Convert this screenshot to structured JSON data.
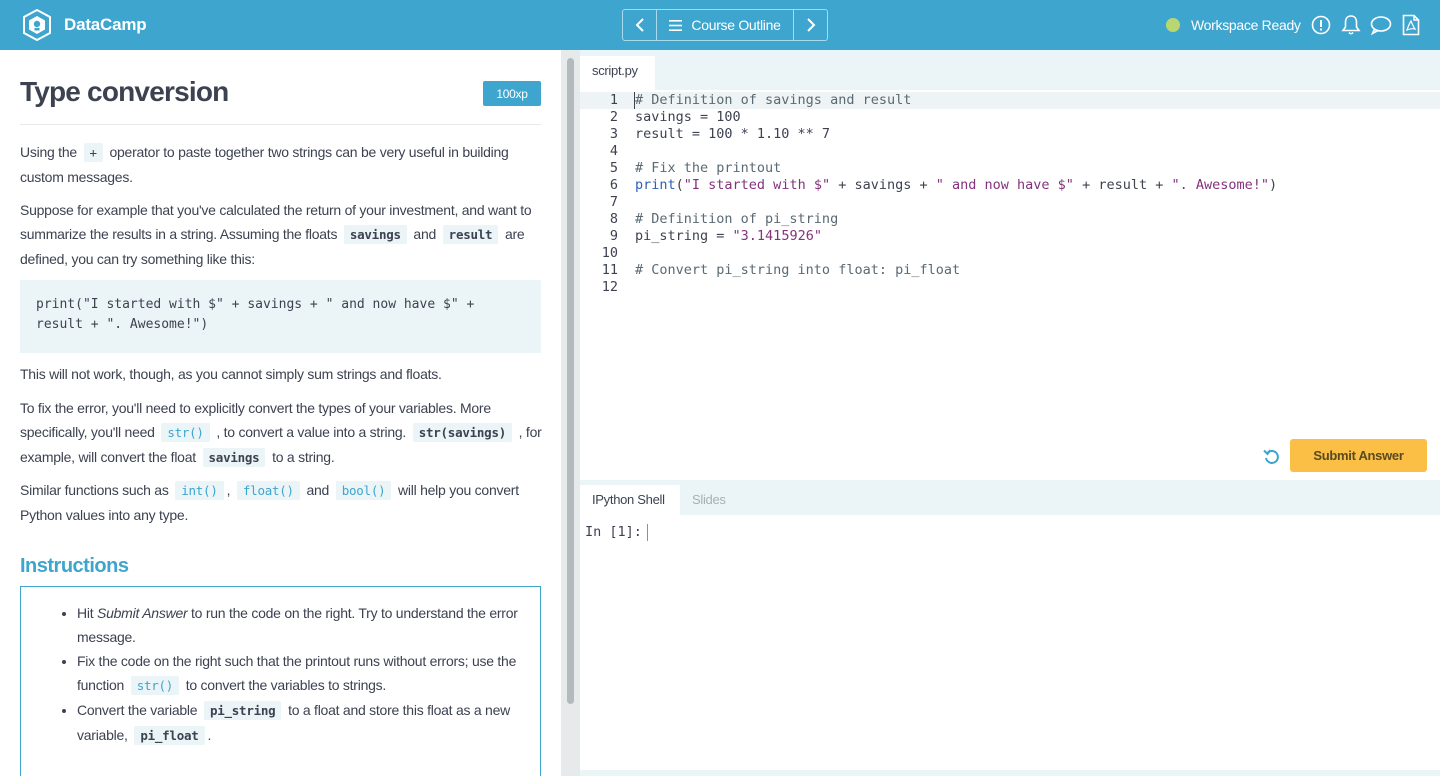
{
  "app": {
    "brand": "DataCamp",
    "course_outline_label": "Course Outline",
    "workspace_status": "Workspace Ready",
    "icons": [
      "issue-icon",
      "notification-bell-icon",
      "chat-icon",
      "pdf-icon"
    ]
  },
  "exercise": {
    "title": "Type conversion",
    "xp": "100xp",
    "p1_before": "Using the",
    "p1_code": "+",
    "p1_after": "operator to paste together two strings can be very useful in building custom messages.",
    "p2_before": "Suppose for example that you've calculated the return of your investment, and want to summarize the results in a string. Assuming the floats",
    "p2_code1": "savings",
    "p2_mid": "and",
    "p2_code2": "result",
    "p2_after": "are defined, you can try something like this:",
    "code_example_line1": "print(\"I started with $\" + savings + \" and now have $\" +",
    "code_example_line2": "result + \". Awesome!\")",
    "p3": "This will not work, though, as you cannot simply sum strings and floats.",
    "p4_before": "To fix the error, you'll need to explicitly convert the types of your variables. More specifically, you'll need",
    "p4_code1": "str()",
    "p4_mid1": ", to convert a value into a string.",
    "p4_code2": "str(savings)",
    "p4_mid2": ", for example, will convert the float",
    "p4_code3": "savings",
    "p4_after": "to a string.",
    "p5_before": "Similar functions such as",
    "p5_code1": "int()",
    "p5_sep1": ",",
    "p5_code2": "float()",
    "p5_sep2": "and",
    "p5_code3": "bool()",
    "p5_after": "will help you convert Python values into any type."
  },
  "instructions": {
    "heading": "Instructions",
    "item1_pre": "Hit",
    "item1_em": "Submit Answer",
    "item1_post": "to run the code on the right. Try to understand the error message.",
    "item2_pre": "Fix the code on the right such that the printout runs without errors; use the function",
    "item2_code": "str()",
    "item2_post": "to convert the variables to strings.",
    "item3_pre": "Convert the variable",
    "item3_code1": "pi_string",
    "item3_mid": "to a float and store this float as a new variable,",
    "item3_code2": "pi_float",
    "item3_post": "."
  },
  "editor": {
    "tab": "script.py",
    "lines": [
      {
        "n": "1",
        "text": "# Definition of savings and result"
      },
      {
        "n": "2",
        "text": "savings = 100"
      },
      {
        "n": "3",
        "text": "result = 100 * 1.10 ** 7"
      },
      {
        "n": "4",
        "text": ""
      },
      {
        "n": "5",
        "text": "# Fix the printout"
      },
      {
        "n": "6",
        "fn": "print",
        "rest1": "(",
        "s1": "\"I started with $\"",
        "rest2": " + savings + ",
        "s2": "\" and now have $\"",
        "rest3": " + result + ",
        "s3": "\". Awesome!\"",
        "rest4": ")"
      },
      {
        "n": "7",
        "text": ""
      },
      {
        "n": "8",
        "text": "# Definition of pi_string"
      },
      {
        "n": "9",
        "pre": "pi_string = ",
        "str": "\"3.1415926\""
      },
      {
        "n": "10",
        "text": ""
      },
      {
        "n": "11",
        "text": "# Convert pi_string into float: pi_float"
      },
      {
        "n": "12",
        "text": ""
      }
    ],
    "submit_label": "Submit Answer"
  },
  "shell": {
    "tab_active": "IPython Shell",
    "tab_inactive": "Slides",
    "prompt": "In [1]:"
  },
  "colors": {
    "brand_blue": "#3ea5cf",
    "submit_yellow": "#fbbf45",
    "status_green": "#b9d771"
  }
}
